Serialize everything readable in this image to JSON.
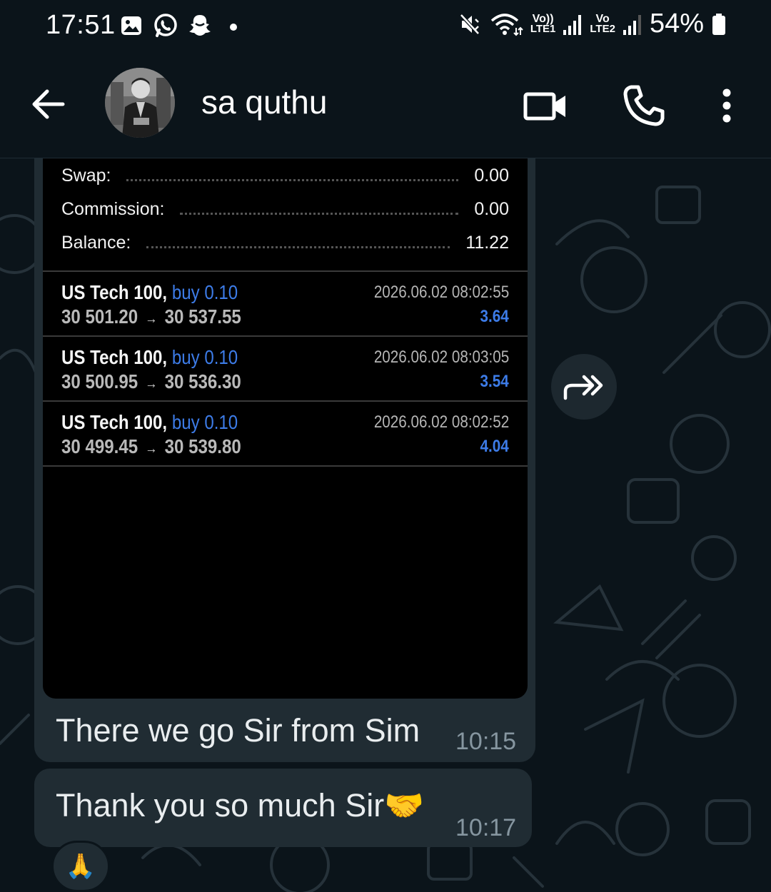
{
  "status_bar": {
    "time": "17:51",
    "battery": "54%",
    "icons": [
      "gallery-icon",
      "whatsapp-icon",
      "snapchat-icon",
      "mute-icon",
      "wifi-icon",
      "signal-icon"
    ],
    "sim1_label": "Vo))",
    "sim1_sub": "LTE1",
    "sim2_label": "Vo",
    "sim2_sub": "LTE2"
  },
  "header": {
    "contact_name": "sa quthu",
    "icons": [
      "back-arrow-icon",
      "video-call-icon",
      "phone-icon",
      "more-vert-icon"
    ]
  },
  "screenshot": {
    "summary": [
      {
        "label": "Swap:",
        "value": "0.00"
      },
      {
        "label": "Commission:",
        "value": "0.00"
      },
      {
        "label": "Balance:",
        "value": "11.22"
      }
    ],
    "deals": [
      {
        "symbol": "US Tech 100,",
        "side": "buy 0.10",
        "open": "30 501.20",
        "close": "30 537.55",
        "arrow": "→",
        "time": "2026.06.02 08:02:55",
        "profit": "3.64"
      },
      {
        "symbol": "US Tech 100,",
        "side": "buy 0.10",
        "open": "30 500.95",
        "close": "30 536.30",
        "arrow": "→",
        "time": "2026.06.02 08:03:05",
        "profit": "3.54"
      },
      {
        "symbol": "US Tech 100,",
        "side": "buy 0.10",
        "open": "30 499.45",
        "close": "30 539.80",
        "arrow": "→",
        "time": "2026.06.02 08:02:52",
        "profit": "4.04"
      }
    ]
  },
  "messages": [
    {
      "text": "There we go Sir from Sim",
      "time": "10:15"
    },
    {
      "text": "Thank you so much Sir",
      "emoji": "🤝",
      "time": "10:17",
      "reaction": "🙏"
    }
  ],
  "colors": {
    "background": "#0b141a",
    "bubble": "#202c33",
    "accent_blue": "#3d7ce8",
    "time_gray": "#8696a0"
  }
}
